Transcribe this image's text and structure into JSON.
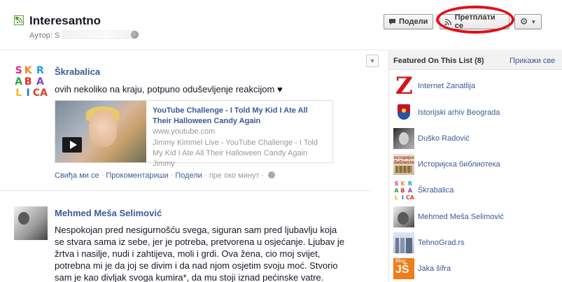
{
  "header": {
    "title": "Interesantno",
    "author_label": "Аутор:",
    "author_initial": "S",
    "share_label": "Подели",
    "subscribe_label": "Претплати се"
  },
  "stories": [
    {
      "author": "Škrabalica",
      "text": "ovih nekoliko na kraju, potpuno oduševljenje reakcijom ♥",
      "attachment": {
        "title": "YouTube Challenge - I Told My Kid I Ate All Their Halloween Candy Again",
        "domain": "www.youtube.com",
        "description": "Jimmy Kimmel Live - YouTube Challenge - I Told My Kid I Ate All Their Halloween Candy Again Jimmy"
      },
      "actions": {
        "like": "Свиђа ми се",
        "comment": "Прокоментариши",
        "share": "Подели",
        "time": "пре око минут"
      }
    },
    {
      "author": "Mehmed Meša Selimović",
      "text": "Nespokojan pred nesigurnošću svega, siguran sam pred ljubavlju koja se stvara sama iz sebe, jer je potreba, pretvorena u osjećanje. Ljubav je žrtva i nasilje, nudi i zahtijeva, moli i grdi. Ova žena, cio moj svijet, potrebna mi je da joj se divim i da nad njom osjetim svoju moć. Stvorio sam je kao divljak svoga kumira*, da mu stoji iznad pećinske vatre."
    }
  ],
  "skrabalica_logo": {
    "letters": [
      "S",
      "K",
      "R",
      "A",
      "B",
      "A",
      "L",
      "I",
      "CA"
    ],
    "colors": [
      "#e02a8a",
      "#f08a1a",
      "#19a0d8",
      "#25a847",
      "#e02a2a",
      "#8a3cc8",
      "#f0b81a",
      "#1a7ad8",
      "#e0402a"
    ]
  },
  "sidebar": {
    "title": "Featured On This List (8)",
    "see_all": "Прикажи све",
    "items": [
      {
        "label": "Internet Zanatlija",
        "icon": "z-logo"
      },
      {
        "label": "Istorijski arhiv Beograda",
        "icon": "coat-of-arms"
      },
      {
        "label": "Duško Radović",
        "icon": "portrait"
      },
      {
        "label": "Историјска библиотека",
        "icon": "library-logo",
        "thumb_text": "историјска библиотека"
      },
      {
        "label": "Škrabalica",
        "icon": "skrabalica-logo"
      },
      {
        "label": "Mehmed Meša Selimović",
        "icon": "portrait"
      },
      {
        "label": "TehnoGrad.rs",
        "icon": "city-skyline"
      },
      {
        "label": "Jaka šifra",
        "icon": "blog-js-logo",
        "thumb_text": "JŠ",
        "thumb_sub": "Blog"
      }
    ]
  },
  "colors": {
    "link": "#3b5998",
    "highlight_ring": "#e0101a"
  }
}
